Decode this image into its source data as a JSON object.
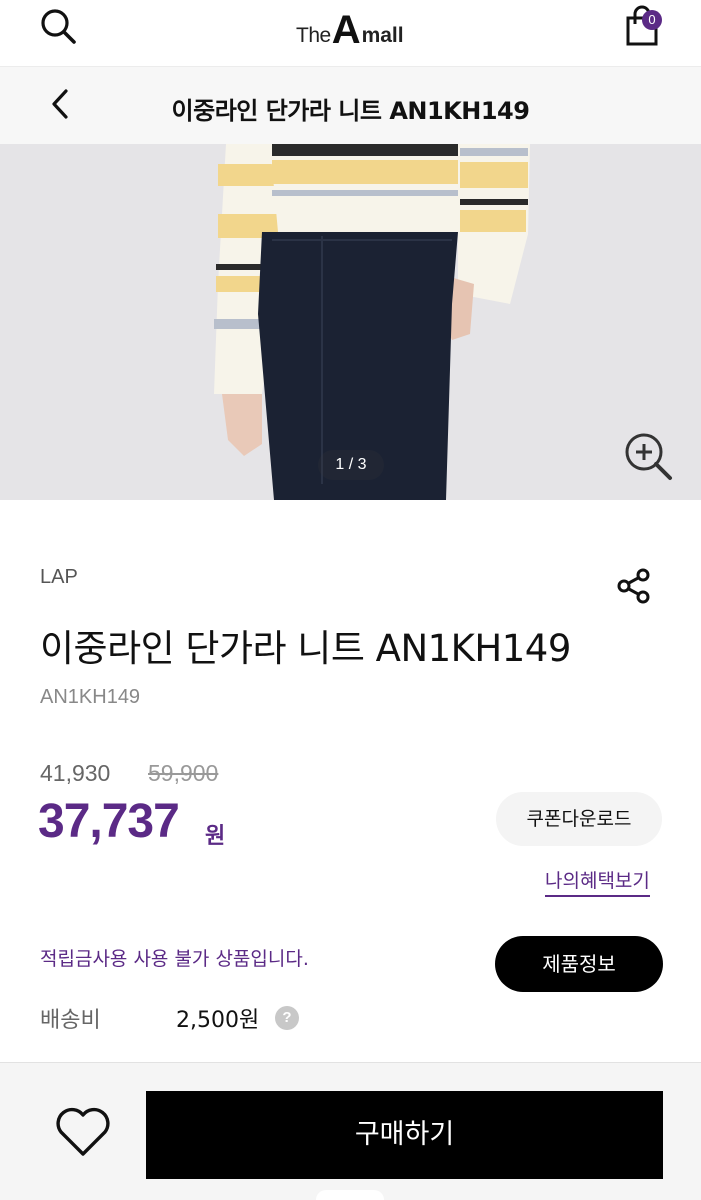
{
  "header": {
    "logo": {
      "the": "The",
      "a": "A",
      "mall": "mall"
    },
    "cart_count": "0",
    "icons": {
      "search": "search-icon",
      "cart": "shopping-bag-icon"
    }
  },
  "titlebar": {
    "title": "이중라인 단가라 니트 AN1KH149",
    "icons": {
      "back": "chevron-left-icon"
    }
  },
  "gallery": {
    "counter": "1 / 3",
    "icons": {
      "zoom": "zoom-in-icon"
    }
  },
  "product": {
    "brand": "LAP",
    "name": "이중라인 단가라 니트 AN1KH149",
    "code": "AN1KH149",
    "price_sale": "41,930",
    "price_original": "59,900",
    "price_final": "37,737",
    "price_unit": "원",
    "icons": {
      "share": "share-icon"
    }
  },
  "actions": {
    "coupon_label": "쿠폰다운로드",
    "benefit_label": "나의혜택보기",
    "product_info_label": "제품정보"
  },
  "notices": {
    "points": "적립금사용 사용 불가 상품입니다."
  },
  "shipping": {
    "label": "배송비",
    "value": "2,500원",
    "help": "?"
  },
  "bottom": {
    "buy_label": "구매하기",
    "icons": {
      "wishlist": "heart-icon"
    }
  },
  "colors": {
    "accent": "#5b2a86",
    "sweater_yellow": "#f2d68c",
    "sweater_cream": "#f7f4ea",
    "pants_navy": "#1b2233",
    "button_black": "#000000"
  }
}
